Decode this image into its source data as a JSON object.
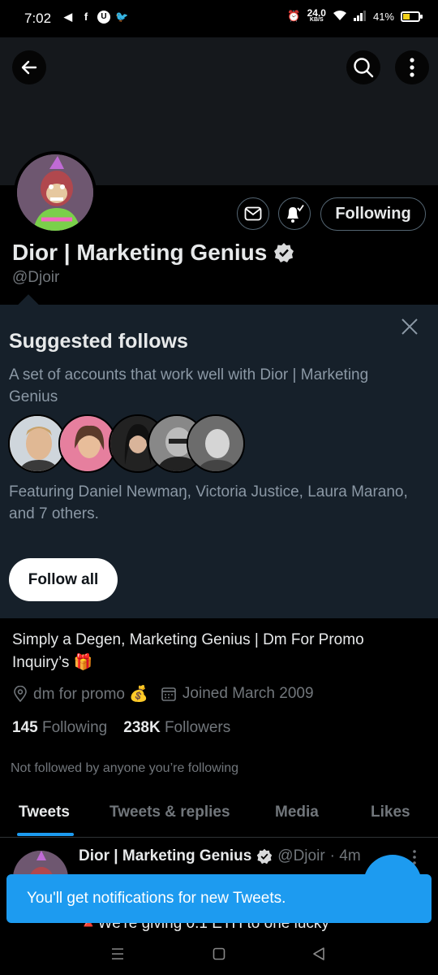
{
  "status_bar": {
    "time": "7:02",
    "left_icons": [
      "telegram-icon",
      "facebook-icon",
      "u-icon",
      "twitter-icon"
    ],
    "data_speed": "24.0",
    "data_unit": "KB/S",
    "battery": "41%"
  },
  "profile": {
    "name": "Dior | Marketing Genius",
    "handle": "@Djoir",
    "following_button": "Following",
    "bio": "Simply a Degen, Marketing Genius | Dm For Promo Inquiry’s 🎁",
    "location": "dm for promo 💰",
    "joined": "Joined March 2009",
    "following_count": "145",
    "following_label": "Following",
    "followers_count": "238K",
    "followers_label": "Followers",
    "not_followed": "Not followed by anyone you’re following"
  },
  "suggested": {
    "title": "Suggested follows",
    "description": "A set of accounts that work well with Dior | Marketing Genius",
    "featuring": "Featuring Daniel Newmaŋ, Victoria Justice, Laura Marano, and 7 others.",
    "follow_all": "Follow all"
  },
  "tabs": [
    "Tweets",
    "Tweets & replies",
    "Media",
    "Likes"
  ],
  "tweet": {
    "name": "Dior | Marketing Genius",
    "handle": "@Djoir",
    "time": "· 4m",
    "partial_text": "🔺We're giving 0.1 ETH  to one lucky"
  },
  "toast": "You'll get notifications for new Tweets.",
  "colors": {
    "accent": "#1d9bf0",
    "background": "#000000",
    "card": "#16202a",
    "banner": "#15181c"
  }
}
